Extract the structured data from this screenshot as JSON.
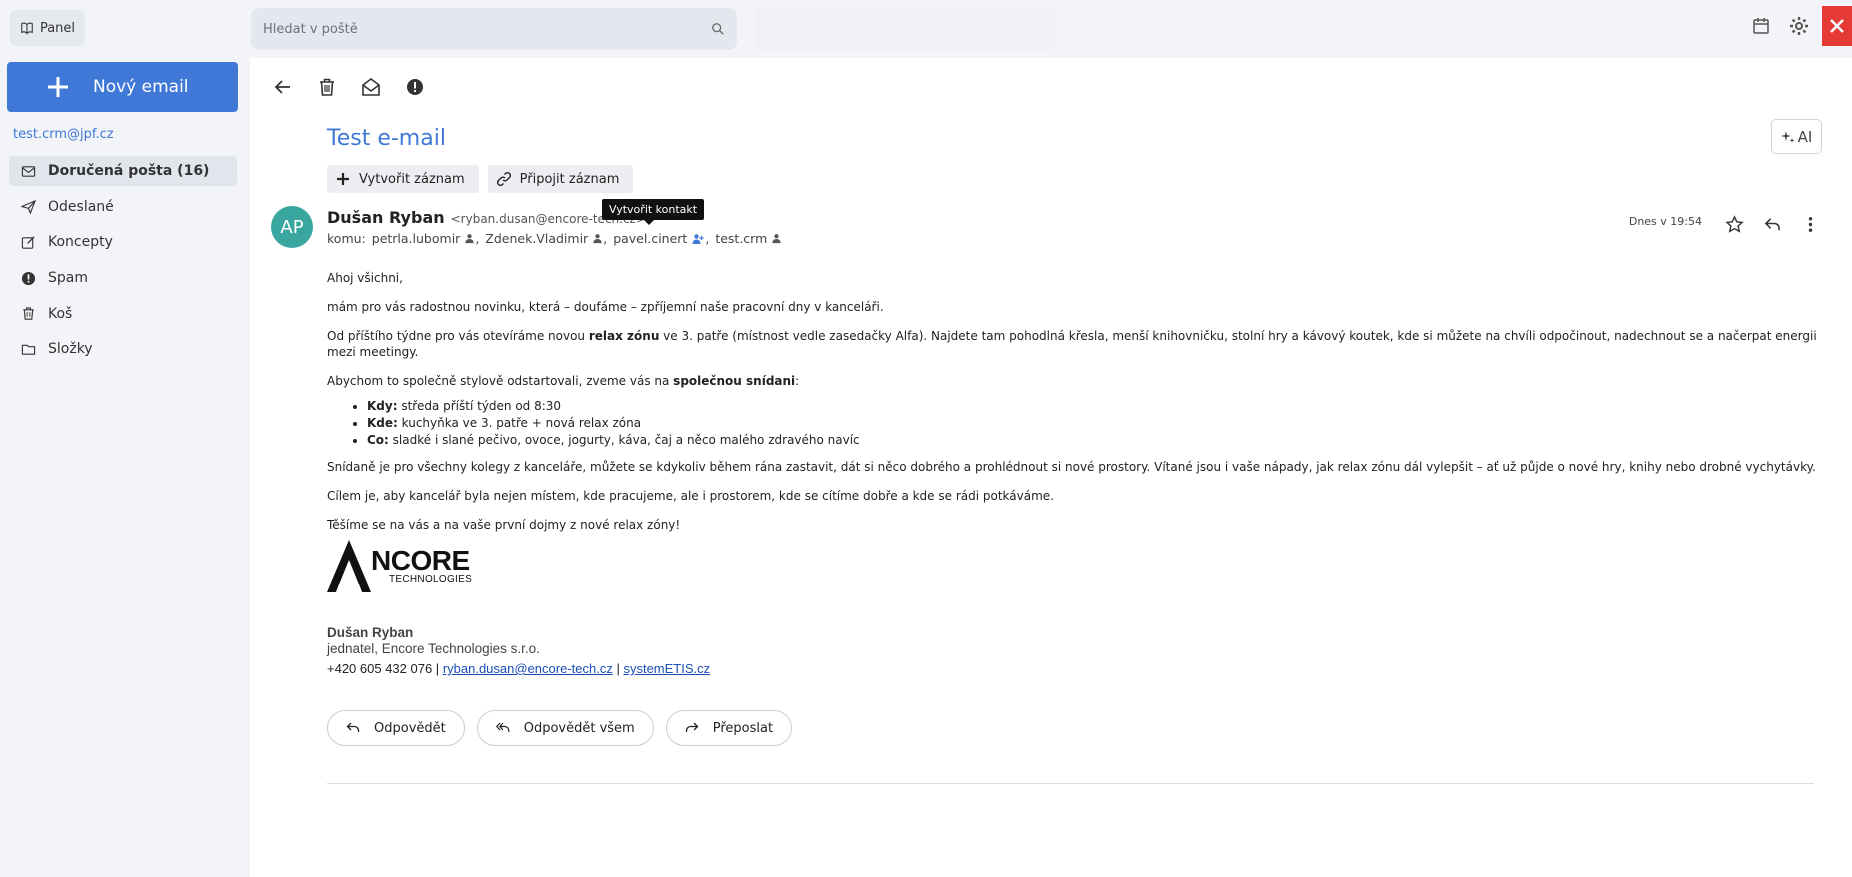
{
  "topbar": {
    "panel_label": "Panel",
    "search_placeholder": "Hledat v poště"
  },
  "sidebar": {
    "new_email_label": "Nový email",
    "account": "test.crm@jpf.cz",
    "items": [
      {
        "label": "Doručená pošta (16)",
        "icon": "inbox-icon",
        "active": true
      },
      {
        "label": "Odeslané",
        "icon": "send-icon"
      },
      {
        "label": "Koncepty",
        "icon": "draft-icon"
      },
      {
        "label": "Spam",
        "icon": "spam-icon"
      },
      {
        "label": "Koš",
        "icon": "trash-icon"
      },
      {
        "label": "Složky",
        "icon": "folder-icon"
      }
    ]
  },
  "message": {
    "subject": "Test e-mail",
    "create_record_label": "Vytvořit záznam",
    "attach_record_label": "Připojit záznam",
    "ai_label": "AI",
    "avatar_initials": "AP",
    "sender_name": "Dušan Ryban",
    "sender_email": "<ryban.dusan@encore-tech.cz>",
    "tooltip": "Vytvořit kontakt",
    "to_prefix": "komu:",
    "recipients": [
      "petrla.lubomir",
      "Zdenek.Vladimir",
      "pavel.cinert",
      "test.crm"
    ],
    "date": "Dnes v 19:54",
    "body": {
      "greeting": "Ahoj všichni,",
      "p1": "mám pro vás radostnou novinku, která – doufáme – zpříjemní naše pracovní dny v kanceláři.",
      "p2_a": "Od příštího týdne pro vás otevíráme novou ",
      "p2_bold": "relax zónu",
      "p2_b": " ve 3. patře (místnost vedle zasedačky Alfa). Najdete tam pohodlná křesla, menší knihovničku, stolní hry a kávový koutek, kde si můžete na chvíli odpočinout, nadechnout se a načerpat energii mezi meetingy.",
      "p3_a": "Abychom to společně stylově odstartovali, zveme vás na ",
      "p3_bold": "společnou snídani",
      "p3_b": ":",
      "list": [
        {
          "label": "Kdy:",
          "text": " středa příští týden od 8:30"
        },
        {
          "label": "Kde:",
          "text": " kuchyňka ve 3. patře + nová relax zóna"
        },
        {
          "label": "Co:",
          "text": " sladké i slané pečivo, ovoce, jogurty, káva, čaj a něco malého zdravého navíc"
        }
      ],
      "p4": "Snídaně je pro všechny kolegy z kanceláře, můžete se kdykoliv během rána zastavit, dát si něco dobrého a prohlédnout si nové prostory. Vítané jsou i vaše nápady, jak relax zónu dál vylepšit – ať už půjde o nové hry, knihy nebo drobné vychytávky.",
      "p5": "Cílem je, aby kancelář byla nejen místem, kde pracujeme, ale i prostorem, kde se cítíme dobře a kde se rádi potkáváme.",
      "p6": "Těšíme se na vás a na vaše první dojmy z nové relax zóny!"
    },
    "logo": {
      "main": "NCORE",
      "sub": "TECHNOLOGIES"
    },
    "signature": {
      "name": "Dušan Ryban",
      "title": "jednatel, Encore Technologies s.r.o.",
      "phone": "+420 605 432 076 |",
      "email": "ryban.dusan@encore-tech.cz",
      "sep": "|",
      "web": "systemETIS.cz"
    },
    "reply_label": "Odpovědět",
    "reply_all_label": "Odpovědět všem",
    "forward_label": "Přeposlat"
  },
  "colors": {
    "accent": "#3f78d6",
    "avatar": "#3aa6a0",
    "close": "#e53935"
  }
}
